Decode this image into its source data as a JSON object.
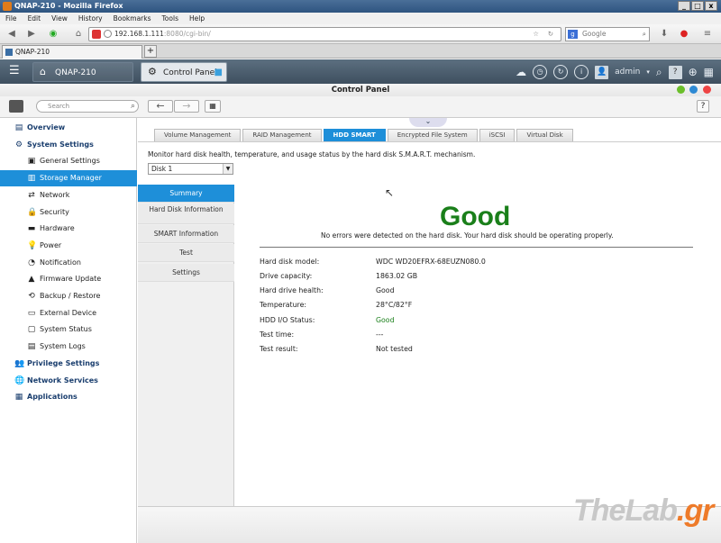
{
  "browser": {
    "window_title": "QNAP-210 - Mozilla Firefox",
    "menu": [
      "File",
      "Edit",
      "View",
      "History",
      "Bookmarks",
      "Tools",
      "Help"
    ],
    "url_host": "192.168.1.111",
    "url_rest": ":8080/cgi-bin/",
    "search_placeholder": "Google",
    "tab_title": "QNAP-210",
    "win_buttons": [
      "_",
      "□",
      "x"
    ]
  },
  "qnap": {
    "home_tab": "QNAP-210",
    "cp_tab": "Control Panel",
    "user": "admin"
  },
  "control_panel": {
    "title": "Control Panel",
    "search_placeholder": "Search"
  },
  "sidebar": {
    "items": [
      {
        "label": "Overview",
        "icon": "overview-icon",
        "level": "top"
      },
      {
        "label": "System Settings",
        "icon": "gear-icon",
        "level": "top"
      },
      {
        "label": "General Settings",
        "icon": "general-settings-icon",
        "level": "sub"
      },
      {
        "label": "Storage Manager",
        "icon": "storage-icon",
        "level": "sub",
        "selected": true
      },
      {
        "label": "Network",
        "icon": "network-icon",
        "level": "sub"
      },
      {
        "label": "Security",
        "icon": "lock-icon",
        "level": "sub"
      },
      {
        "label": "Hardware",
        "icon": "hardware-icon",
        "level": "sub"
      },
      {
        "label": "Power",
        "icon": "power-icon",
        "level": "sub"
      },
      {
        "label": "Notification",
        "icon": "notification-icon",
        "level": "sub"
      },
      {
        "label": "Firmware Update",
        "icon": "firmware-icon",
        "level": "sub"
      },
      {
        "label": "Backup / Restore",
        "icon": "backup-icon",
        "level": "sub"
      },
      {
        "label": "External Device",
        "icon": "external-device-icon",
        "level": "sub"
      },
      {
        "label": "System Status",
        "icon": "monitor-icon",
        "level": "sub"
      },
      {
        "label": "System Logs",
        "icon": "logs-icon",
        "level": "sub"
      },
      {
        "label": "Privilege Settings",
        "icon": "user-icon",
        "level": "top"
      },
      {
        "label": "Network Services",
        "icon": "globe-icon",
        "level": "top"
      },
      {
        "label": "Applications",
        "icon": "apps-icon",
        "level": "top"
      }
    ]
  },
  "storage_tabs": [
    "Volume Management",
    "RAID Management",
    "HDD SMART",
    "Encrypted File System",
    "iSCSI",
    "Virtual Disk"
  ],
  "active_storage_tab": "HDD SMART",
  "description": "Monitor hard disk health, temperature, and usage status by the hard disk S.M.A.R.T. mechanism.",
  "disk_select": {
    "value": "Disk 1"
  },
  "left_nav": [
    "Summary",
    "Hard Disk Information",
    "SMART Information",
    "Test",
    "Settings"
  ],
  "summary": {
    "status": "Good",
    "message": "No errors were detected on the hard disk. Your hard disk should be operating properly.",
    "rows": [
      {
        "label": "Hard disk model:",
        "value": "WDC WD20EFRX-68EUZN080.0"
      },
      {
        "label": "Drive capacity:",
        "value": "1863.02 GB"
      },
      {
        "label": "Hard drive health:",
        "value": "Good"
      },
      {
        "label": "Temperature:",
        "value": "28°C/82°F"
      },
      {
        "label": "HDD I/O Status:",
        "value": "Good"
      },
      {
        "label": "Test time:",
        "value": "---"
      },
      {
        "label": "Test result:",
        "value": "Not tested"
      }
    ]
  },
  "watermark": {
    "text": "TheLab",
    "dot": ".gr"
  },
  "colors": {
    "accent": "#1e8fd9",
    "good": "#1a7f1a"
  }
}
